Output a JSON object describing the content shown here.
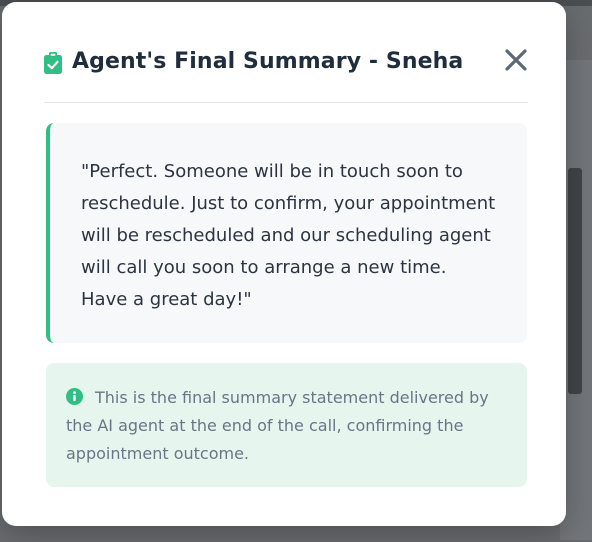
{
  "modal": {
    "title": "Agent's Final Summary - Sneha",
    "title_icon": "clipboard-check-icon",
    "close_icon": "close-icon",
    "quote": "\"Perfect. Someone will be in touch soon to reschedule. Just to confirm, your appointment will be rescheduled and our scheduling agent will call you soon to arrange a new time. Have a great day!\"",
    "info_icon": "info-circle-icon",
    "info_text": "This is the final summary statement delivered by the AI agent at the end of the call, confirming the appointment outcome."
  },
  "colors": {
    "accent": "#2fbf85",
    "title_text": "#1f2d3d",
    "quote_background": "#f6f8fa",
    "info_background": "#e6f6ef",
    "info_text": "#6a7584",
    "close_icon": "#5a6878"
  }
}
